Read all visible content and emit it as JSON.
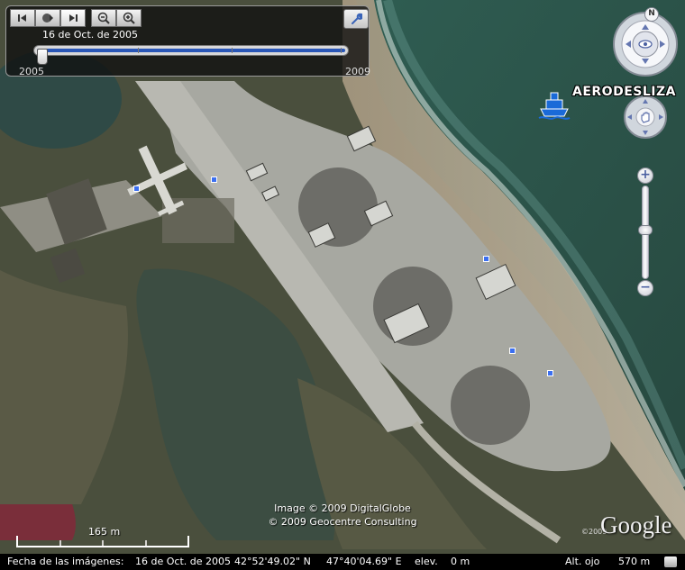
{
  "time_slider": {
    "current_date": "16 de Oct. de 2005",
    "start_year": "2005",
    "end_year": "2009",
    "position_fraction": 0.0,
    "buttons": [
      "go-back-icon",
      "clock-icon",
      "go-forward-icon",
      "zoom-out-icon",
      "zoom-in-icon"
    ],
    "settings_icon": "wrench-icon"
  },
  "navigation": {
    "compass_north": "N",
    "look_icon": "eye-icon",
    "move_icon": "hand-icon",
    "zoom_in": "+",
    "zoom_out": "−",
    "zoom_level_fraction": 0.62
  },
  "placemark": {
    "label": "AERODESLIZA",
    "icon": "ship-icon",
    "color": "#1a6ad8"
  },
  "credits": {
    "line1": "Image © 2009 DigitalGlobe",
    "line2": "© 2009 Geocentre Consulting"
  },
  "logo": {
    "text": "Google",
    "year": "©2009"
  },
  "scale": {
    "label": "165 m"
  },
  "status_bar": {
    "imagery_date_label": "Fecha de las imágenes:",
    "imagery_date": "16 de Oct. de 2005",
    "latitude": "42°52'49.02\" N",
    "longitude": "47°40'04.69\" E",
    "elev_label": "elev.",
    "elev_value": "0 m",
    "eye_alt_label": "Alt. ojo",
    "eye_alt_value": "570 m"
  },
  "colors": {
    "sea": "#2e5a4c",
    "land": "#4a533e",
    "concrete": "#a8a8a2",
    "marker": "#3b6ff0"
  }
}
